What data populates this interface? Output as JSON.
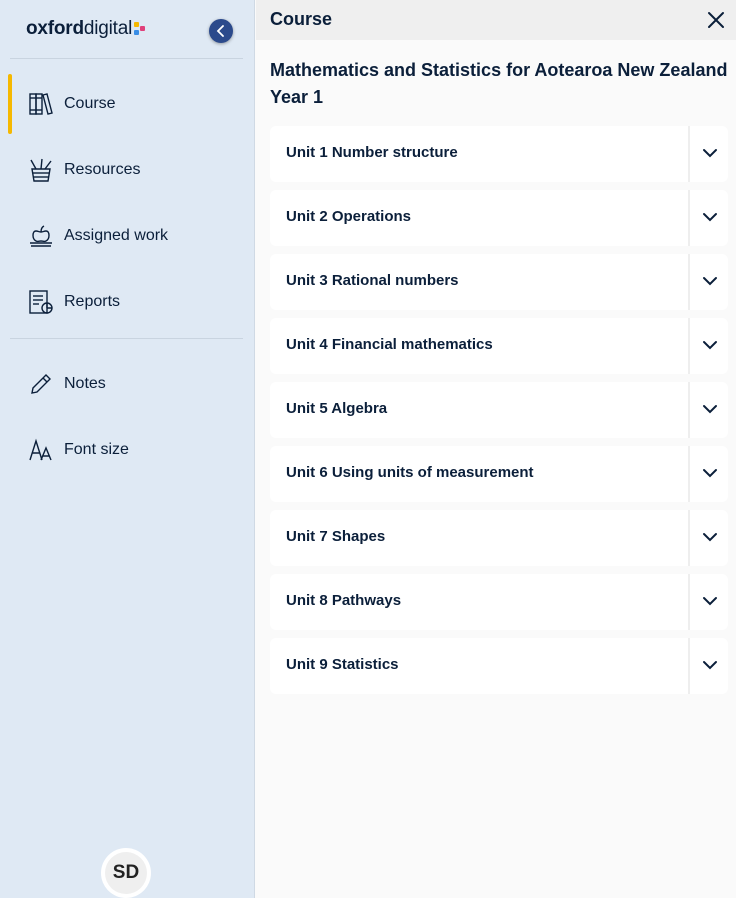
{
  "brand": {
    "name_bold": "oxford",
    "name_light": "digital",
    "colors": {
      "navy": "#0b1f3a",
      "accent": "#f5b800",
      "collapse": "#2b4a8c",
      "sidebar_bg": "#dfe9f4"
    }
  },
  "sidebar": {
    "collapse_icon": "chevron-left-icon",
    "items": [
      {
        "label": "Course",
        "icon": "books-icon",
        "active": true
      },
      {
        "label": "Resources",
        "icon": "pencil-cup-icon",
        "active": false
      },
      {
        "label": "Assigned work",
        "icon": "apple-book-icon",
        "active": false
      },
      {
        "label": "Reports",
        "icon": "report-icon",
        "active": false
      }
    ],
    "tools": [
      {
        "label": "Notes",
        "icon": "pencil-icon"
      },
      {
        "label": "Font size",
        "icon": "font-size-icon"
      }
    ],
    "avatar": {
      "initials": "SD"
    }
  },
  "panel": {
    "header_title": "Course",
    "close_icon": "close-icon",
    "course_title": "Mathematics and Statistics for Aotearoa New Zealand Year 1",
    "units": [
      {
        "label": "Unit 1 Number structure"
      },
      {
        "label": "Unit 2 Operations"
      },
      {
        "label": "Unit 3 Rational numbers"
      },
      {
        "label": "Unit 4 Financial mathematics"
      },
      {
        "label": "Unit 5 Algebra"
      },
      {
        "label": "Unit 6 Using units of measurement"
      },
      {
        "label": "Unit 7 Shapes"
      },
      {
        "label": "Unit 8 Pathways"
      },
      {
        "label": "Unit 9 Statistics"
      }
    ]
  }
}
